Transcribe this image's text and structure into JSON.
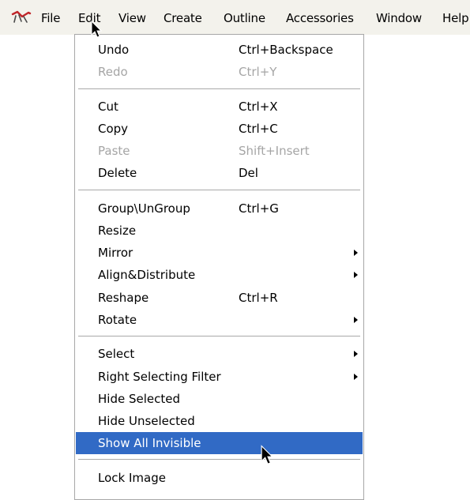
{
  "menubar": {
    "items": [
      {
        "label": "File"
      },
      {
        "label": "Edit"
      },
      {
        "label": "View"
      },
      {
        "label": "Create"
      },
      {
        "label": "Outline"
      },
      {
        "label": "Accessories"
      },
      {
        "label": "Window"
      },
      {
        "label": "Help"
      }
    ]
  },
  "edit_menu": {
    "items": [
      {
        "label": "Undo",
        "shortcut": "Ctrl+Backspace"
      },
      {
        "label": "Redo",
        "shortcut": "Ctrl+Y",
        "disabled": true
      },
      {
        "label": "Cut",
        "shortcut": "Ctrl+X"
      },
      {
        "label": "Copy",
        "shortcut": "Ctrl+C"
      },
      {
        "label": "Paste",
        "shortcut": "Shift+Insert",
        "disabled": true
      },
      {
        "label": "Delete",
        "shortcut": "Del"
      },
      {
        "label": "Group\\UnGroup",
        "shortcut": "Ctrl+G"
      },
      {
        "label": "Resize",
        "shortcut": ""
      },
      {
        "label": "Mirror",
        "shortcut": "",
        "submenu": true
      },
      {
        "label": "Align&Distribute",
        "shortcut": "",
        "submenu": true
      },
      {
        "label": "Reshape",
        "shortcut": "Ctrl+R"
      },
      {
        "label": "Rotate",
        "shortcut": "",
        "submenu": true
      },
      {
        "label": "Select",
        "shortcut": "",
        "submenu": true
      },
      {
        "label": "Right Selecting Filter",
        "shortcut": "",
        "submenu": true
      },
      {
        "label": "Hide Selected",
        "shortcut": ""
      },
      {
        "label": "Hide Unselected",
        "shortcut": ""
      },
      {
        "label": "Show All Invisible",
        "shortcut": "",
        "highlighted": true
      },
      {
        "label": "Lock Image",
        "shortcut": ""
      }
    ]
  },
  "colors": {
    "menubar_bg": "#f3f2ec",
    "highlight_bg": "#316ac5",
    "disabled_text": "#a5a5a5"
  },
  "icons": {
    "app": "app-logo-icon",
    "submenu": "chevron-right-icon",
    "cursor": "mouse-pointer-icon"
  }
}
